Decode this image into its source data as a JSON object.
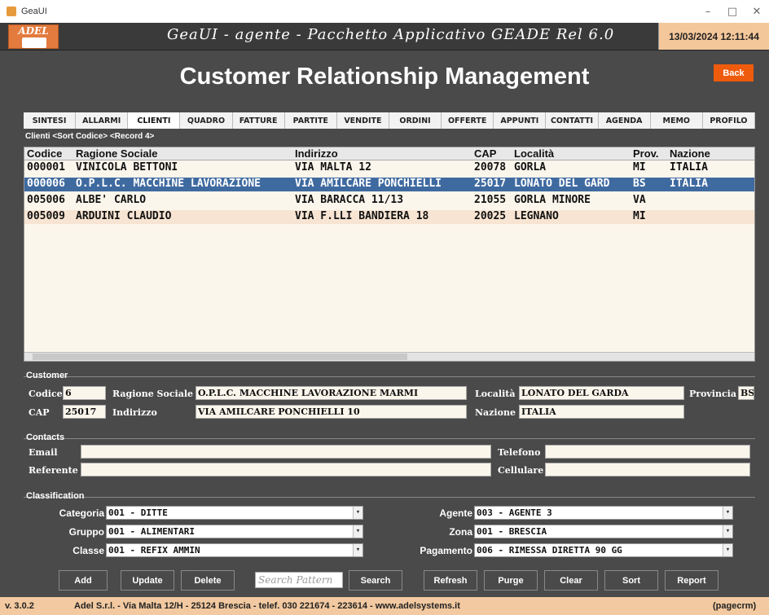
{
  "window": {
    "title": "GeaUI",
    "minimize": "–",
    "maximize": "□",
    "close": "✕"
  },
  "header": {
    "logo_text": "ADEL",
    "app_title": "GeaUI - agente - Pacchetto Applicativo GEADE Rel 6.0",
    "datetime": "13/03/2024 12:11:44"
  },
  "page_title": "Customer Relationship Management",
  "back_label": "Back",
  "tabs": [
    "SINTESI",
    "ALLARMI",
    "CLIENTI",
    "QUADRO",
    "FATTURE",
    "PARTITE",
    "VENDITE",
    "ORDINI",
    "OFFERTE",
    "APPUNTI",
    "CONTATTI",
    "AGENDA",
    "MEMO",
    "PROFILO"
  ],
  "active_tab": "CLIENTI",
  "list_header": "Clienti <Sort Codice> <Record 4>",
  "grid": {
    "columns": [
      "Codice",
      "Ragione Sociale",
      "Indirizzo",
      "CAP",
      "Località",
      "Prov.",
      "Nazione"
    ],
    "rows": [
      [
        "000001",
        "VINICOLA BETTONI",
        "VIA MALTA 12",
        "20078",
        "GORLA",
        "MI",
        "ITALIA"
      ],
      [
        "000006",
        "O.P.L.C. MACCHINE LAVORAZIONE",
        "VIA AMILCARE PONCHIELLI",
        "25017",
        "LONATO DEL GARD",
        "BS",
        "ITALIA"
      ],
      [
        "005006",
        "ALBE' CARLO",
        "VIA BARACCA 11/13",
        "21055",
        "GORLA MINORE",
        "VA",
        ""
      ],
      [
        "005009",
        "ARDUINI CLAUDIO",
        "VIA F.LLI BANDIERA 18",
        "20025",
        "LEGNANO",
        "MI",
        ""
      ]
    ],
    "selected_row": 1
  },
  "customer": {
    "section": "Customer",
    "codice_label": "Codice",
    "codice": "6",
    "ragione_label": "Ragione Sociale",
    "ragione": "O.P.L.C. MACCHINE LAVORAZIONE MARMI",
    "localita_label": "Località",
    "localita": "LONATO DEL GARDA",
    "provincia_label": "Provincia",
    "provincia": "BS",
    "cap_label": "CAP",
    "cap": "25017",
    "indirizzo_label": "Indirizzo",
    "indirizzo": "VIA AMILCARE PONCHIELLI 10",
    "nazione_label": "Nazione",
    "nazione": "ITALIA"
  },
  "contacts": {
    "section": "Contacts",
    "email_label": "Email",
    "email": "",
    "telefono_label": "Telefono",
    "telefono": "",
    "referente_label": "Referente",
    "referente": "",
    "cellulare_label": "Cellulare",
    "cellulare": ""
  },
  "classification": {
    "section": "Classification",
    "categoria_label": "Categoria",
    "categoria": "001 - DITTE",
    "gruppo_label": "Gruppo",
    "gruppo": "001 - ALIMENTARI",
    "classe_label": "Classe",
    "classe": "001 - REFIX AMMIN",
    "agente_label": "Agente",
    "agente": "003 - AGENTE 3",
    "zona_label": "Zona",
    "zona": "001 - BRESCIA",
    "pagamento_label": "Pagamento",
    "pagamento": "006 - RIMESSA DIRETTA 90 GG"
  },
  "buttons": {
    "add": "Add",
    "update": "Update",
    "delete": "Delete",
    "search_placeholder": "Search Pattern",
    "search": "Search",
    "refresh": "Refresh",
    "purge": "Purge",
    "clear": "Clear",
    "sort": "Sort",
    "report": "Report"
  },
  "footer": {
    "version": "v. 3.0.2",
    "company": "Adel S.r.l. - Via Malta 12/H - 25124 Brescia - telef. 030 221674 - 223614 - www.adelsystems.it",
    "page": "(pagecrm)"
  },
  "colors": {
    "accent": "#ef5b0c",
    "selection": "#3f6aa0",
    "background": "#4a4a4a",
    "footer": "#f2c9a0"
  }
}
